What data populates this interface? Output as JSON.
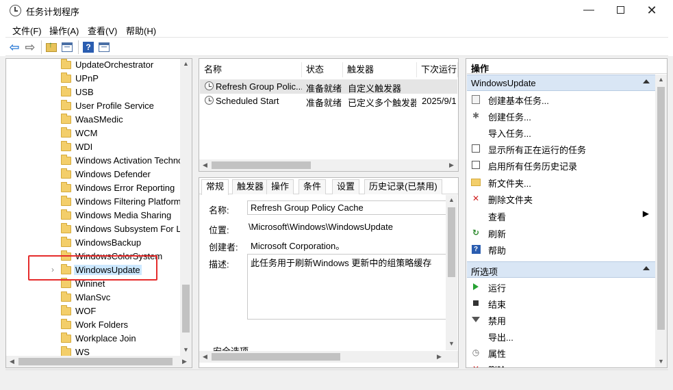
{
  "window": {
    "title": "任务计划程序",
    "minimize": "—",
    "close": "✕"
  },
  "menu": [
    "文件(F)",
    "操作(A)",
    "查看(V)",
    "帮助(H)"
  ],
  "toolbar": {
    "back": "⇦",
    "forward": "⇨",
    "help": "?"
  },
  "tree": {
    "items": [
      "UpdateOrchestrator",
      "UPnP",
      "USB",
      "User Profile Service",
      "WaaSMedic",
      "WCM",
      "WDI",
      "Windows Activation Techno",
      "Windows Defender",
      "Windows Error Reporting",
      "Windows Filtering Platform",
      "Windows Media Sharing",
      "Windows Subsystem For Lin",
      "WindowsBackup",
      "WindowsColorSystem",
      "WindowsUpdate",
      "Wininet",
      "WlanSvc",
      "WOF",
      "Work Folders",
      "Workplace Join",
      "WS"
    ],
    "selected_index": 15,
    "expander": "›"
  },
  "tasklist": {
    "columns": [
      "名称",
      "状态",
      "触发器",
      "下次运行时"
    ],
    "rows": [
      {
        "name": "Refresh Group Polic...",
        "status": "准备就绪",
        "trigger": "自定义触发器",
        "next": ""
      },
      {
        "name": "Scheduled Start",
        "status": "准备就绪",
        "trigger": "已定义多个触发器",
        "next": "2025/9/1"
      }
    ]
  },
  "detail": {
    "tabs": [
      "常规",
      "触发器",
      "操作",
      "条件",
      "设置",
      "历史记录(已禁用)"
    ],
    "name_label": "名称:",
    "name_value": "Refresh Group Policy Cache",
    "location_label": "位置:",
    "location_value": "\\Microsoft\\Windows\\WindowsUpdate",
    "author_label": "创建者:",
    "author_value": "Microsoft Corporation。",
    "desc_label": "描述:",
    "desc_value": "此任务用于刷新Windows 更新中的组策略缓存",
    "security_label": "安全选项"
  },
  "actions": {
    "title": "操作",
    "section1": {
      "label": "WindowsUpdate",
      "items": [
        {
          "label": "创建基本任务...",
          "icon": "basic-task-icon"
        },
        {
          "label": "创建任务...",
          "icon": "create-task-icon"
        },
        {
          "label": "导入任务...",
          "icon": "none"
        },
        {
          "label": "显示所有正在运行的任务",
          "icon": "running-tasks-icon"
        },
        {
          "label": "启用所有任务历史记录",
          "icon": "history-icon"
        },
        {
          "label": "新文件夹...",
          "icon": "new-folder-icon"
        },
        {
          "label": "删除文件夹",
          "icon": "delete-icon"
        },
        {
          "label": "查看",
          "icon": "none"
        },
        {
          "label": "刷新",
          "icon": "refresh-icon"
        },
        {
          "label": "帮助",
          "icon": "help-icon"
        }
      ]
    },
    "section2": {
      "label": "所选项",
      "items": [
        {
          "label": "运行",
          "icon": "run-icon"
        },
        {
          "label": "结束",
          "icon": "stop-icon"
        },
        {
          "label": "禁用",
          "icon": "disable-icon"
        },
        {
          "label": "导出...",
          "icon": "none"
        },
        {
          "label": "属性",
          "icon": "properties-icon"
        },
        {
          "label": "删除",
          "icon": "delete-icon"
        }
      ]
    },
    "submenu_arrow": "▶"
  },
  "colors": {
    "selection": "#cce8ff",
    "section_header": "#d9e6f5",
    "highlight_box": "#e52b2b"
  }
}
